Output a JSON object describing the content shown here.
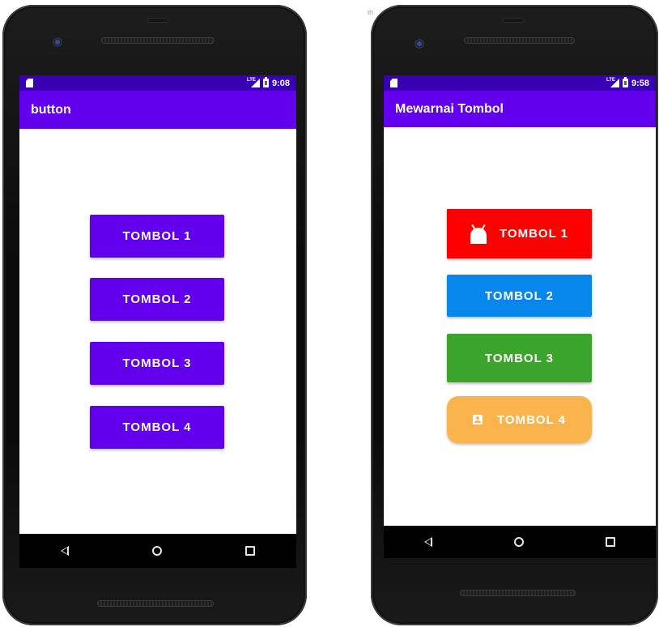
{
  "colors": {
    "primary": "#6200ee",
    "status_bar": "#3700b3",
    "white": "#ffffff",
    "btn_red": "#ff0000",
    "btn_blue": "#0787ec",
    "btn_green": "#3ba42c",
    "btn_orange": "#f9b44e"
  },
  "left_phone": {
    "status_bar": {
      "time": "9:08",
      "icons": [
        "sim-card-icon",
        "lte-signal-icon",
        "battery-icon"
      ]
    },
    "app_bar": {
      "title": "button"
    },
    "buttons": [
      {
        "label": "TOMBOL 1",
        "color": "#6200ee"
      },
      {
        "label": "TOMBOL 2",
        "color": "#6200ee"
      },
      {
        "label": "TOMBOL 3",
        "color": "#6200ee"
      },
      {
        "label": "TOMBOL 4",
        "color": "#6200ee"
      }
    ],
    "nav_bar": {
      "icons": [
        "back-icon",
        "home-icon",
        "recents-icon"
      ]
    }
  },
  "right_phone": {
    "status_bar": {
      "time": "9:58",
      "icons": [
        "sim-card-icon",
        "lte-signal-icon",
        "battery-icon"
      ]
    },
    "app_bar": {
      "title": "Mewarnai Tombol"
    },
    "buttons": [
      {
        "label": "TOMBOL 1",
        "color": "#ff0000",
        "icon": "android-icon"
      },
      {
        "label": "TOMBOL 2",
        "color": "#0787ec"
      },
      {
        "label": "TOMBOL 3",
        "color": "#3ba42c"
      },
      {
        "label": "TOMBOL 4",
        "color": "#f9b44e",
        "icon": "contact-icon"
      }
    ],
    "nav_bar": {
      "icons": [
        "back-icon",
        "home-icon",
        "recents-icon"
      ]
    }
  }
}
